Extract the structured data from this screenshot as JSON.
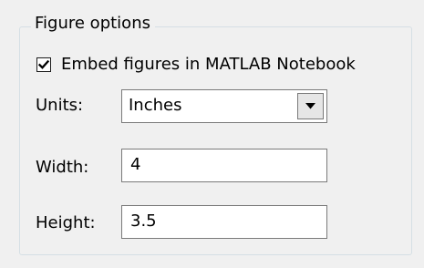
{
  "figure_options": {
    "title": "Figure options",
    "embed_checkbox": {
      "label": "Embed figures in MATLAB Notebook",
      "checked": true,
      "icon": "checkmark-icon"
    },
    "units": {
      "label": "Units:",
      "value": "Inches",
      "icon": "chevron-down-icon"
    },
    "width": {
      "label": "Width:",
      "value": "4"
    },
    "height": {
      "label": "Height:",
      "value": "3.5"
    }
  }
}
